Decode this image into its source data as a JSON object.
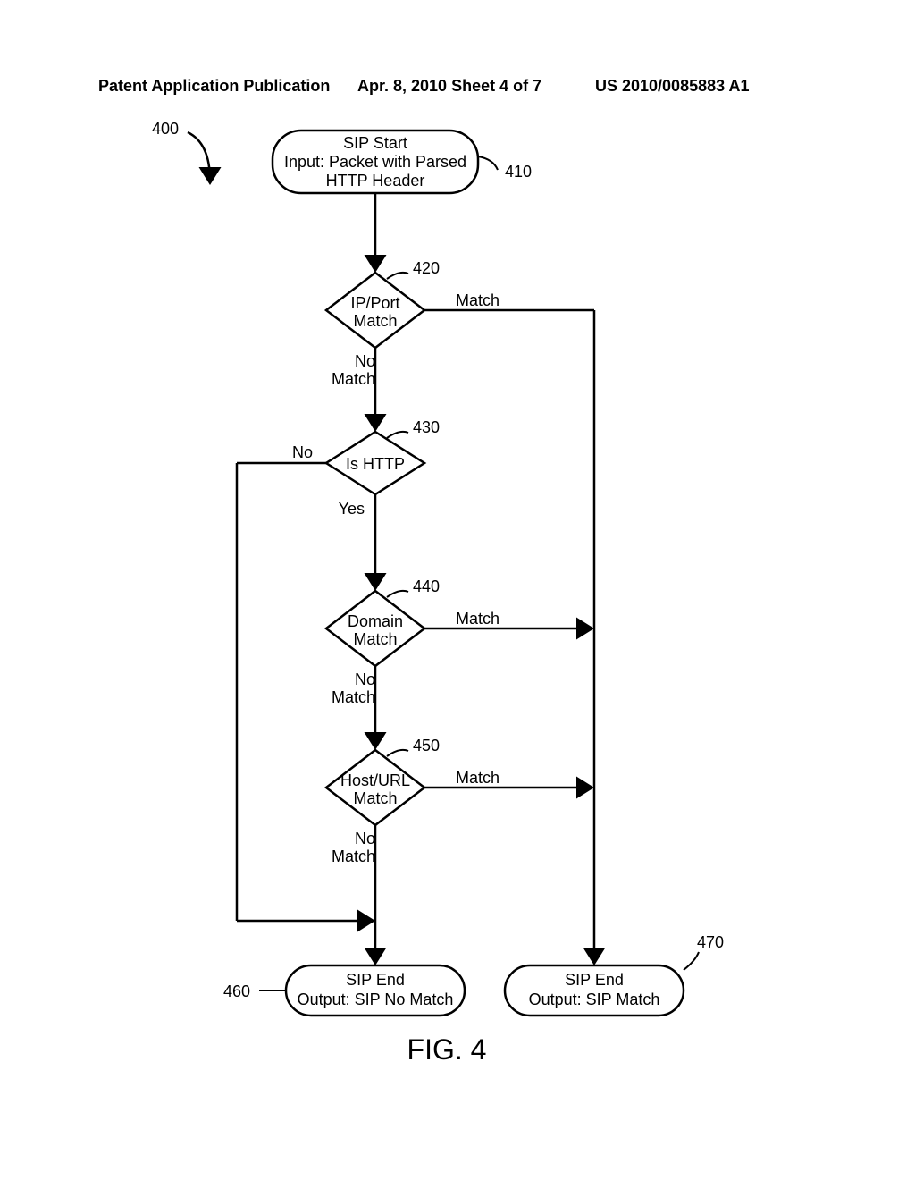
{
  "header": {
    "left": "Patent Application Publication",
    "center": "Apr. 8, 2010  Sheet 4 of 7",
    "right": "US 2010/0085883 A1"
  },
  "labels": {
    "ref400": "400",
    "ref410": "410",
    "ref420": "420",
    "ref430": "430",
    "ref440": "440",
    "ref450": "450",
    "ref460": "460",
    "ref470": "470"
  },
  "nodes": {
    "start_line1": "SIP Start",
    "start_line2": "Input: Packet with Parsed",
    "start_line3": "HTTP Header",
    "d420_line1": "IP/Port",
    "d420_line2": "Match",
    "d430": "Is HTTP",
    "d440_line1": "Domain",
    "d440_line2": "Match",
    "d450_line1": "Host/URL",
    "d450_line2": "Match",
    "end460_line1": "SIP End",
    "end460_line2": "Output: SIP No Match",
    "end470_line1": "SIP End",
    "end470_line2": "Output: SIP Match"
  },
  "edge_labels": {
    "match": "Match",
    "no_match_line1": "No",
    "no_match_line2": "Match",
    "no": "No",
    "yes": "Yes"
  },
  "figure_caption": "FIG. 4"
}
